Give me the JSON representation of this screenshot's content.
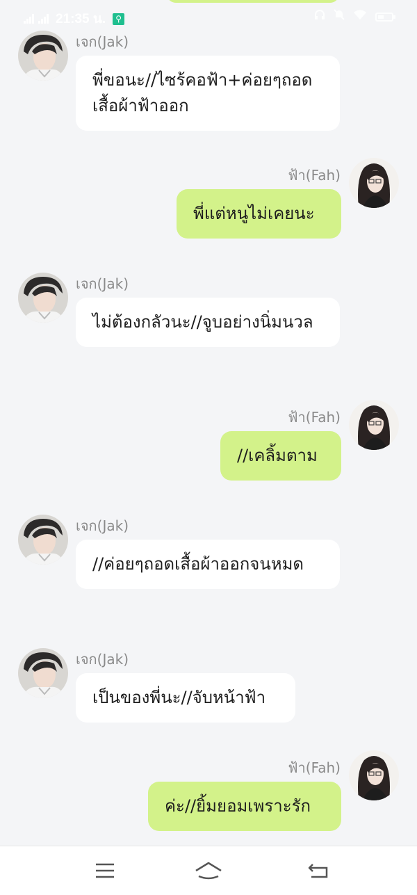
{
  "status_bar": {
    "time": "21:35 น.",
    "icons": [
      "signal-icon",
      "signal-icon",
      "app-badge-icon",
      "headphones-icon",
      "mute-icon",
      "wifi-icon",
      "battery-icon"
    ]
  },
  "participants": {
    "jak": {
      "name": "เจก(Jak)"
    },
    "fah": {
      "name": "ฟ้า(Fah)"
    }
  },
  "messages": [
    {
      "sender": "เจก(Jak)",
      "side": "left",
      "text": "พี่ขอนะ//ไซร้คอฟ้า+ค่อยๆถอดเสื้อผ้าฟ้าออก"
    },
    {
      "sender": "ฟ้า(Fah)",
      "side": "right",
      "text": "พี่แต่หนูไม่เคยนะ"
    },
    {
      "sender": "เจก(Jak)",
      "side": "left",
      "text": "ไม่ต้องกลัวนะ//จูบอย่างนิ่มนวล"
    },
    {
      "sender": "ฟ้า(Fah)",
      "side": "right",
      "text": "//เคลิ้มตาม"
    },
    {
      "sender": "เจก(Jak)",
      "side": "left",
      "text": "//ค่อยๆถอดเสื้อผ้าออกจนหมด"
    },
    {
      "sender": "เจก(Jak)",
      "side": "left",
      "text": "เป็นของพี่นะ//จับหน้าฟ้า"
    },
    {
      "sender": "ฟ้า(Fah)",
      "side": "right",
      "text": "ค่ะ//ยิ้มยอมเพราะรัก"
    }
  ],
  "colors": {
    "background": "#f4f5f7",
    "incoming_bubble": "#ffffff",
    "outgoing_bubble": "#d3f28a",
    "name_text": "#8a8a8a"
  },
  "nav_bar": {
    "buttons": [
      "menu-icon",
      "home-icon",
      "back-icon"
    ]
  }
}
